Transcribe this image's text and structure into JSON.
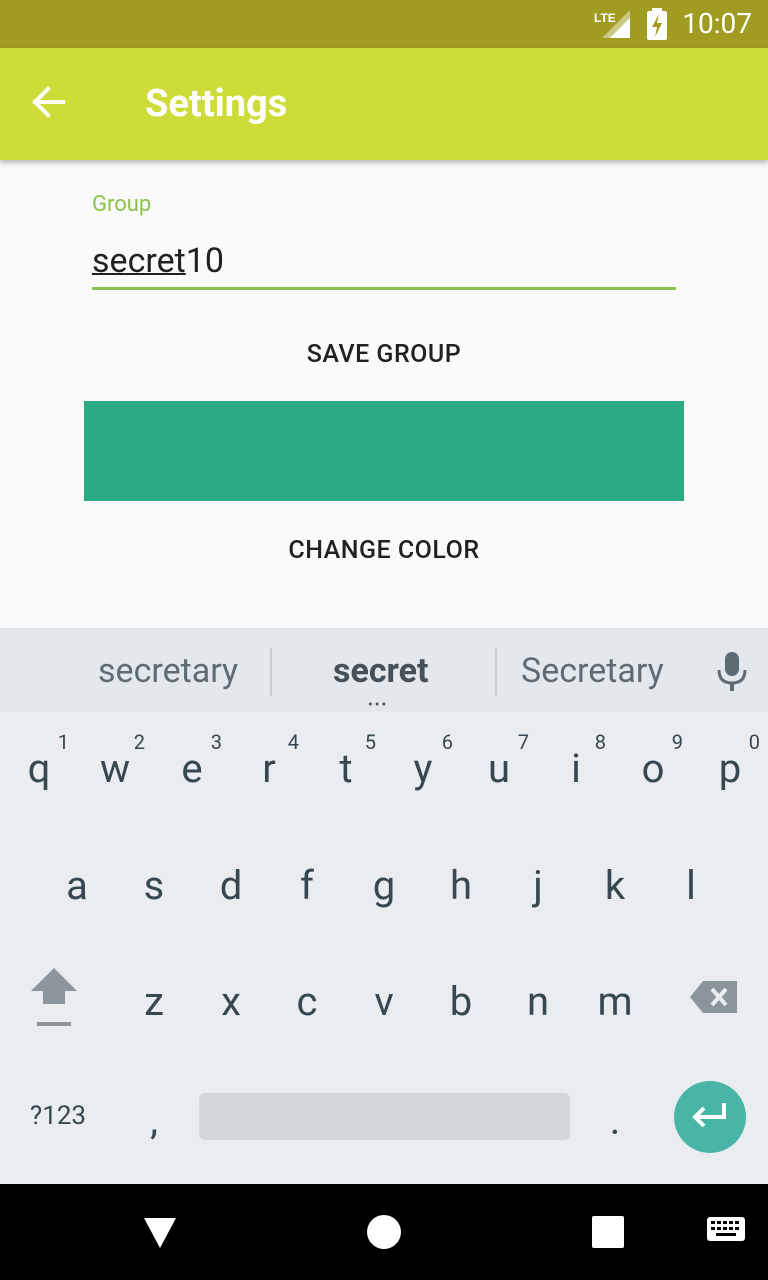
{
  "status_bar": {
    "time": "10:07",
    "network": "LTE"
  },
  "app_bar": {
    "title": "Settings"
  },
  "form": {
    "group_label": "Group",
    "group_value_composing": "secret",
    "group_value_rest": "10",
    "save_button": "SAVE GROUP",
    "color_swatch": "#2bab83",
    "change_color_button": "CHANGE COLOR"
  },
  "keyboard": {
    "suggestions": [
      "secretary",
      "secret",
      "Secretary"
    ],
    "row1": [
      {
        "key": "q",
        "hint": "1"
      },
      {
        "key": "w",
        "hint": "2"
      },
      {
        "key": "e",
        "hint": "3"
      },
      {
        "key": "r",
        "hint": "4"
      },
      {
        "key": "t",
        "hint": "5"
      },
      {
        "key": "y",
        "hint": "6"
      },
      {
        "key": "u",
        "hint": "7"
      },
      {
        "key": "i",
        "hint": "8"
      },
      {
        "key": "o",
        "hint": "9"
      },
      {
        "key": "p",
        "hint": "0"
      }
    ],
    "row2": [
      "a",
      "s",
      "d",
      "f",
      "g",
      "h",
      "j",
      "k",
      "l"
    ],
    "row3": [
      "z",
      "x",
      "c",
      "v",
      "b",
      "n",
      "m"
    ],
    "symbols_key": "?123",
    "comma_key": ",",
    "period_key": ".",
    "accent_color": "#48b5a7"
  }
}
